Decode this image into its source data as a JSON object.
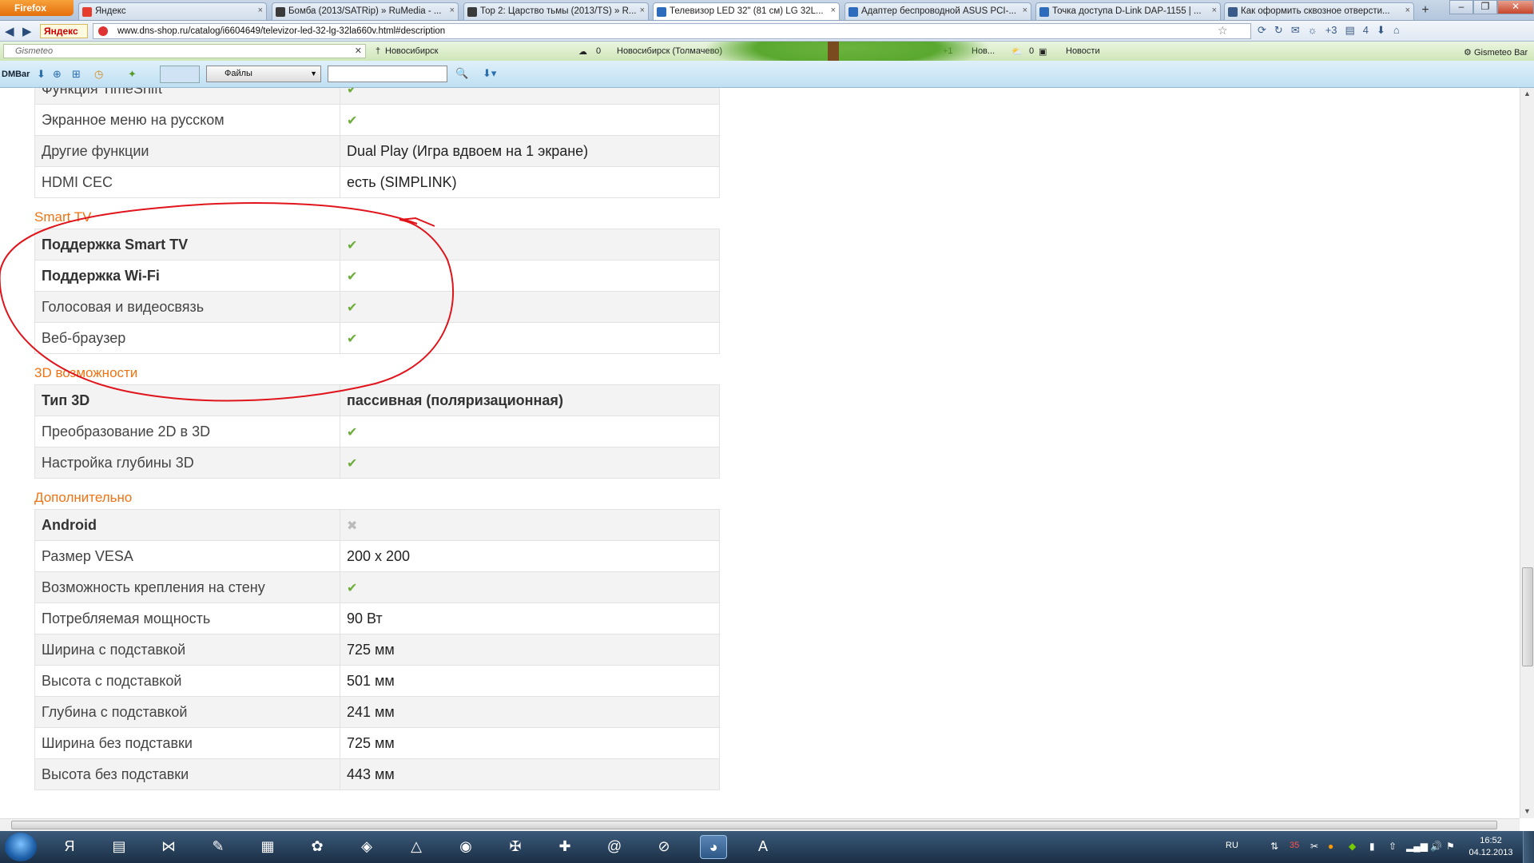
{
  "browser": {
    "app_button": "Firefox",
    "tabs": [
      {
        "title": "Яндекс",
        "color": "#e53c2e",
        "active": false
      },
      {
        "title": "Бомба (2013/SATRip) » RuMedia - ...",
        "color": "#3a3a3a",
        "active": false
      },
      {
        "title": "Тор 2: Царство тьмы (2013/TS) » R...",
        "color": "#3a3a3a",
        "active": false
      },
      {
        "title": "Телевизор LED 32\" (81 см) LG 32L...",
        "color": "#2d6bbd",
        "active": true
      },
      {
        "title": "Адаптер беспроводной ASUS PCI-...",
        "color": "#2d6bbd",
        "active": false
      },
      {
        "title": "Точка доступа D-Link DAP-1155 | ...",
        "color": "#2d6bbd",
        "active": false
      },
      {
        "title": "Как оформить сквозное отверсти...",
        "color": "#3a5a8a",
        "active": false
      }
    ],
    "new_tab": "+",
    "yandex_label": "Яндекс",
    "url": "www.dns-shop.ru/catalog/i6604649/televizor-led-32-lg-32la660v.html#description",
    "nav_extras": {
      "badge_plus3": "+3",
      "badge_4": "4"
    }
  },
  "gismeteo": {
    "search_placeholder": "Gismeteo",
    "city1": "Новосибирск",
    "city2_temp": "0",
    "city2": "Новосибирск (Толмачево)",
    "temp_plus1": "+1",
    "news_short": "Нов...",
    "temp_0": "0",
    "news": "Новости",
    "bar_label": "Gismeteo Bar"
  },
  "dmbar": {
    "label": "DMBar",
    "files_select": "Файлы"
  },
  "spec": {
    "groups": [
      {
        "title": "",
        "rows": [
          {
            "label": "Функция TimeShift",
            "value": "",
            "mark": "check",
            "bold": false
          },
          {
            "label": "Экранное меню на русском",
            "value": "",
            "mark": "check",
            "bold": false
          },
          {
            "label": "Другие функции",
            "value": "Dual Play (Игра вдвоем на 1 экране)",
            "mark": "",
            "bold": false
          },
          {
            "label": "HDMI CEC",
            "value": "есть (SIMPLINK)",
            "mark": "",
            "bold": false
          }
        ]
      },
      {
        "title": "Smart TV",
        "rows": [
          {
            "label": "Поддержка Smart TV",
            "value": "",
            "mark": "check",
            "bold": true
          },
          {
            "label": "Поддержка Wi-Fi",
            "value": "",
            "mark": "check",
            "bold": true
          },
          {
            "label": "Голосовая и видеосвязь",
            "value": "",
            "mark": "check",
            "bold": false
          },
          {
            "label": "Веб-браузер",
            "value": "",
            "mark": "check",
            "bold": false
          }
        ]
      },
      {
        "title": "3D возможности",
        "rows": [
          {
            "label": "Тип 3D",
            "value": "пассивная (поляризационная)",
            "mark": "",
            "bold": true
          },
          {
            "label": "Преобразование 2D в 3D",
            "value": "",
            "mark": "check",
            "bold": false
          },
          {
            "label": "Настройка глубины 3D",
            "value": "",
            "mark": "check",
            "bold": false
          }
        ]
      },
      {
        "title": "Дополнительно",
        "rows": [
          {
            "label": "Android",
            "value": "",
            "mark": "cross",
            "bold": true
          },
          {
            "label": "Размер VESA",
            "value": "200 x 200",
            "mark": "",
            "bold": false
          },
          {
            "label": "Возможность крепления на стену",
            "value": "",
            "mark": "check",
            "bold": false
          },
          {
            "label": "Потребляемая мощность",
            "value": "90 Вт",
            "mark": "",
            "bold": false
          },
          {
            "label": "Ширина с подставкой",
            "value": "725 мм",
            "mark": "",
            "bold": false
          },
          {
            "label": "Высота с подставкой",
            "value": "501 мм",
            "mark": "",
            "bold": false
          },
          {
            "label": "Глубина с подставкой",
            "value": "241 мм",
            "mark": "",
            "bold": false
          },
          {
            "label": "Ширина без подставки",
            "value": "725 мм",
            "mark": "",
            "bold": false
          },
          {
            "label": "Высота без подставки",
            "value": "443 мм",
            "mark": "",
            "bold": false
          }
        ]
      }
    ]
  },
  "marks": {
    "check": "✔",
    "cross": "✖"
  },
  "colors": {
    "accent": "#ef7314",
    "check": "#6dad3a",
    "annotation": "#e0141a"
  },
  "taskbar": {
    "icons": [
      "start",
      "yandex",
      "explorer",
      "visual-studio",
      "notepad",
      "calculator",
      "paint",
      "nhl14",
      "avast",
      "gtalk",
      "game",
      "world-of-tanks",
      "mail-agent",
      "satellite",
      "firefox",
      "dmaster"
    ],
    "lang": "RU",
    "tray_badge": "35",
    "time": "16:52",
    "date": "04.12.2013"
  }
}
